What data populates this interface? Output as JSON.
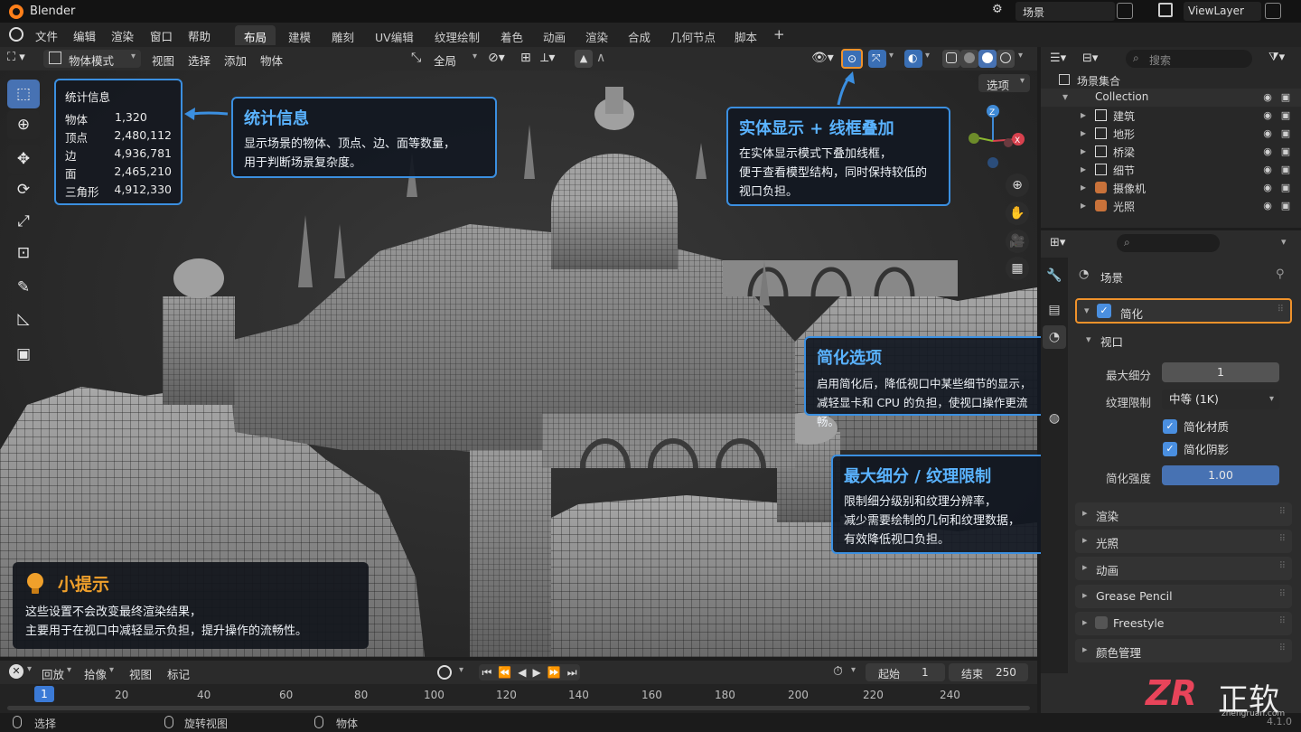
{
  "titlebar": {
    "app_title": "Blender",
    "scene_name": "场景",
    "view_layer": "ViewLayer"
  },
  "menu": [
    "文件",
    "编辑",
    "渲染",
    "窗口",
    "帮助"
  ],
  "workspaces": [
    "布局",
    "建模",
    "雕刻",
    "UV编辑",
    "纹理绘制",
    "着色",
    "动画",
    "渲染",
    "合成",
    "几何节点",
    "脚本"
  ],
  "workspace_add": "+",
  "viewport_header": {
    "mode": "物体模式",
    "menus": [
      "视图",
      "选择",
      "添加",
      "物体"
    ],
    "transform_orientation": "全局",
    "options_button": "选项"
  },
  "stats": {
    "title": "统计信息",
    "rows": [
      {
        "label": "物体",
        "value": "1,320"
      },
      {
        "label": "顶点",
        "value": "2,480,112"
      },
      {
        "label": "边",
        "value": "4,936,781"
      },
      {
        "label": "面",
        "value": "2,465,210"
      },
      {
        "label": "三角形",
        "value": "4,912,330"
      }
    ]
  },
  "callouts": {
    "stats": {
      "title": "统计信息",
      "lines": [
        "显示场景的物体、顶点、边、面等数量，",
        "用于判断场景复杂度。"
      ]
    },
    "overlay": {
      "title": "实体显示 + 线框叠加",
      "lines": [
        "在实体显示模式下叠加线框，",
        "便于查看模型结构，同时保持较低的",
        "视口负担。"
      ]
    },
    "simplify": {
      "title": "简化选项",
      "lines": [
        "启用简化后，降低视口中某些细节的显示，",
        "减轻显卡和 CPU 的负担，使视口操作更流畅。"
      ]
    },
    "subdiv": {
      "title": "最大细分 / 纹理限制",
      "lines": [
        "限制细分级别和纹理分辨率，",
        "减少需要绘制的几何和纹理数据，",
        "有效降低视口负担。"
      ]
    },
    "tip": {
      "title": "小提示",
      "lines": [
        "这些设置不会改变最终渲染结果，",
        "主要用于在视口中减轻显示负担，提升操作的流畅性。"
      ]
    }
  },
  "gizmo": {
    "x": "X",
    "z": "Z"
  },
  "outliner": {
    "search_placeholder": "搜索",
    "scene_collection": "场景集合",
    "collection": "Collection",
    "items": [
      "建筑",
      "地形",
      "桥梁",
      "细节",
      "摄像机",
      "光照"
    ]
  },
  "properties": {
    "scene_label": "场景",
    "simplify_panel": "简化",
    "viewport_subpanel": "视口",
    "max_subdiv_label": "最大细分",
    "max_subdiv_value": "1",
    "texture_limit_label": "纹理限制",
    "texture_limit_value": "中等 (1K)",
    "simplify_materials": "简化材质",
    "simplify_shadows": "简化阴影",
    "simplify_strength_label": "简化强度",
    "simplify_strength_value": "1.00",
    "other_panels": [
      "渲染",
      "光照",
      "动画",
      "Grease Pencil",
      "Freestyle",
      "颜色管理"
    ]
  },
  "timeline": {
    "menus": [
      "回放",
      "拾像",
      "视图",
      "标记"
    ],
    "start_label": "起始",
    "start_value": "1",
    "end_label": "结束",
    "end_value": "250",
    "current_frame": "1",
    "ticks": [
      "20",
      "40",
      "60",
      "80",
      "100",
      "120",
      "140",
      "160",
      "180",
      "200",
      "220",
      "240"
    ]
  },
  "statusbar": {
    "select": "选择",
    "rotate_view": "旋转视图",
    "object": "物体",
    "version": "4.1.0"
  },
  "watermark": {
    "logo": "ZR",
    "text": "正软",
    "url": "zhengruan.com"
  },
  "colors": {
    "accent_blue": "#3b8fe0",
    "highlight_orange": "#f0922b",
    "callout_title": "#5ab3ff"
  }
}
